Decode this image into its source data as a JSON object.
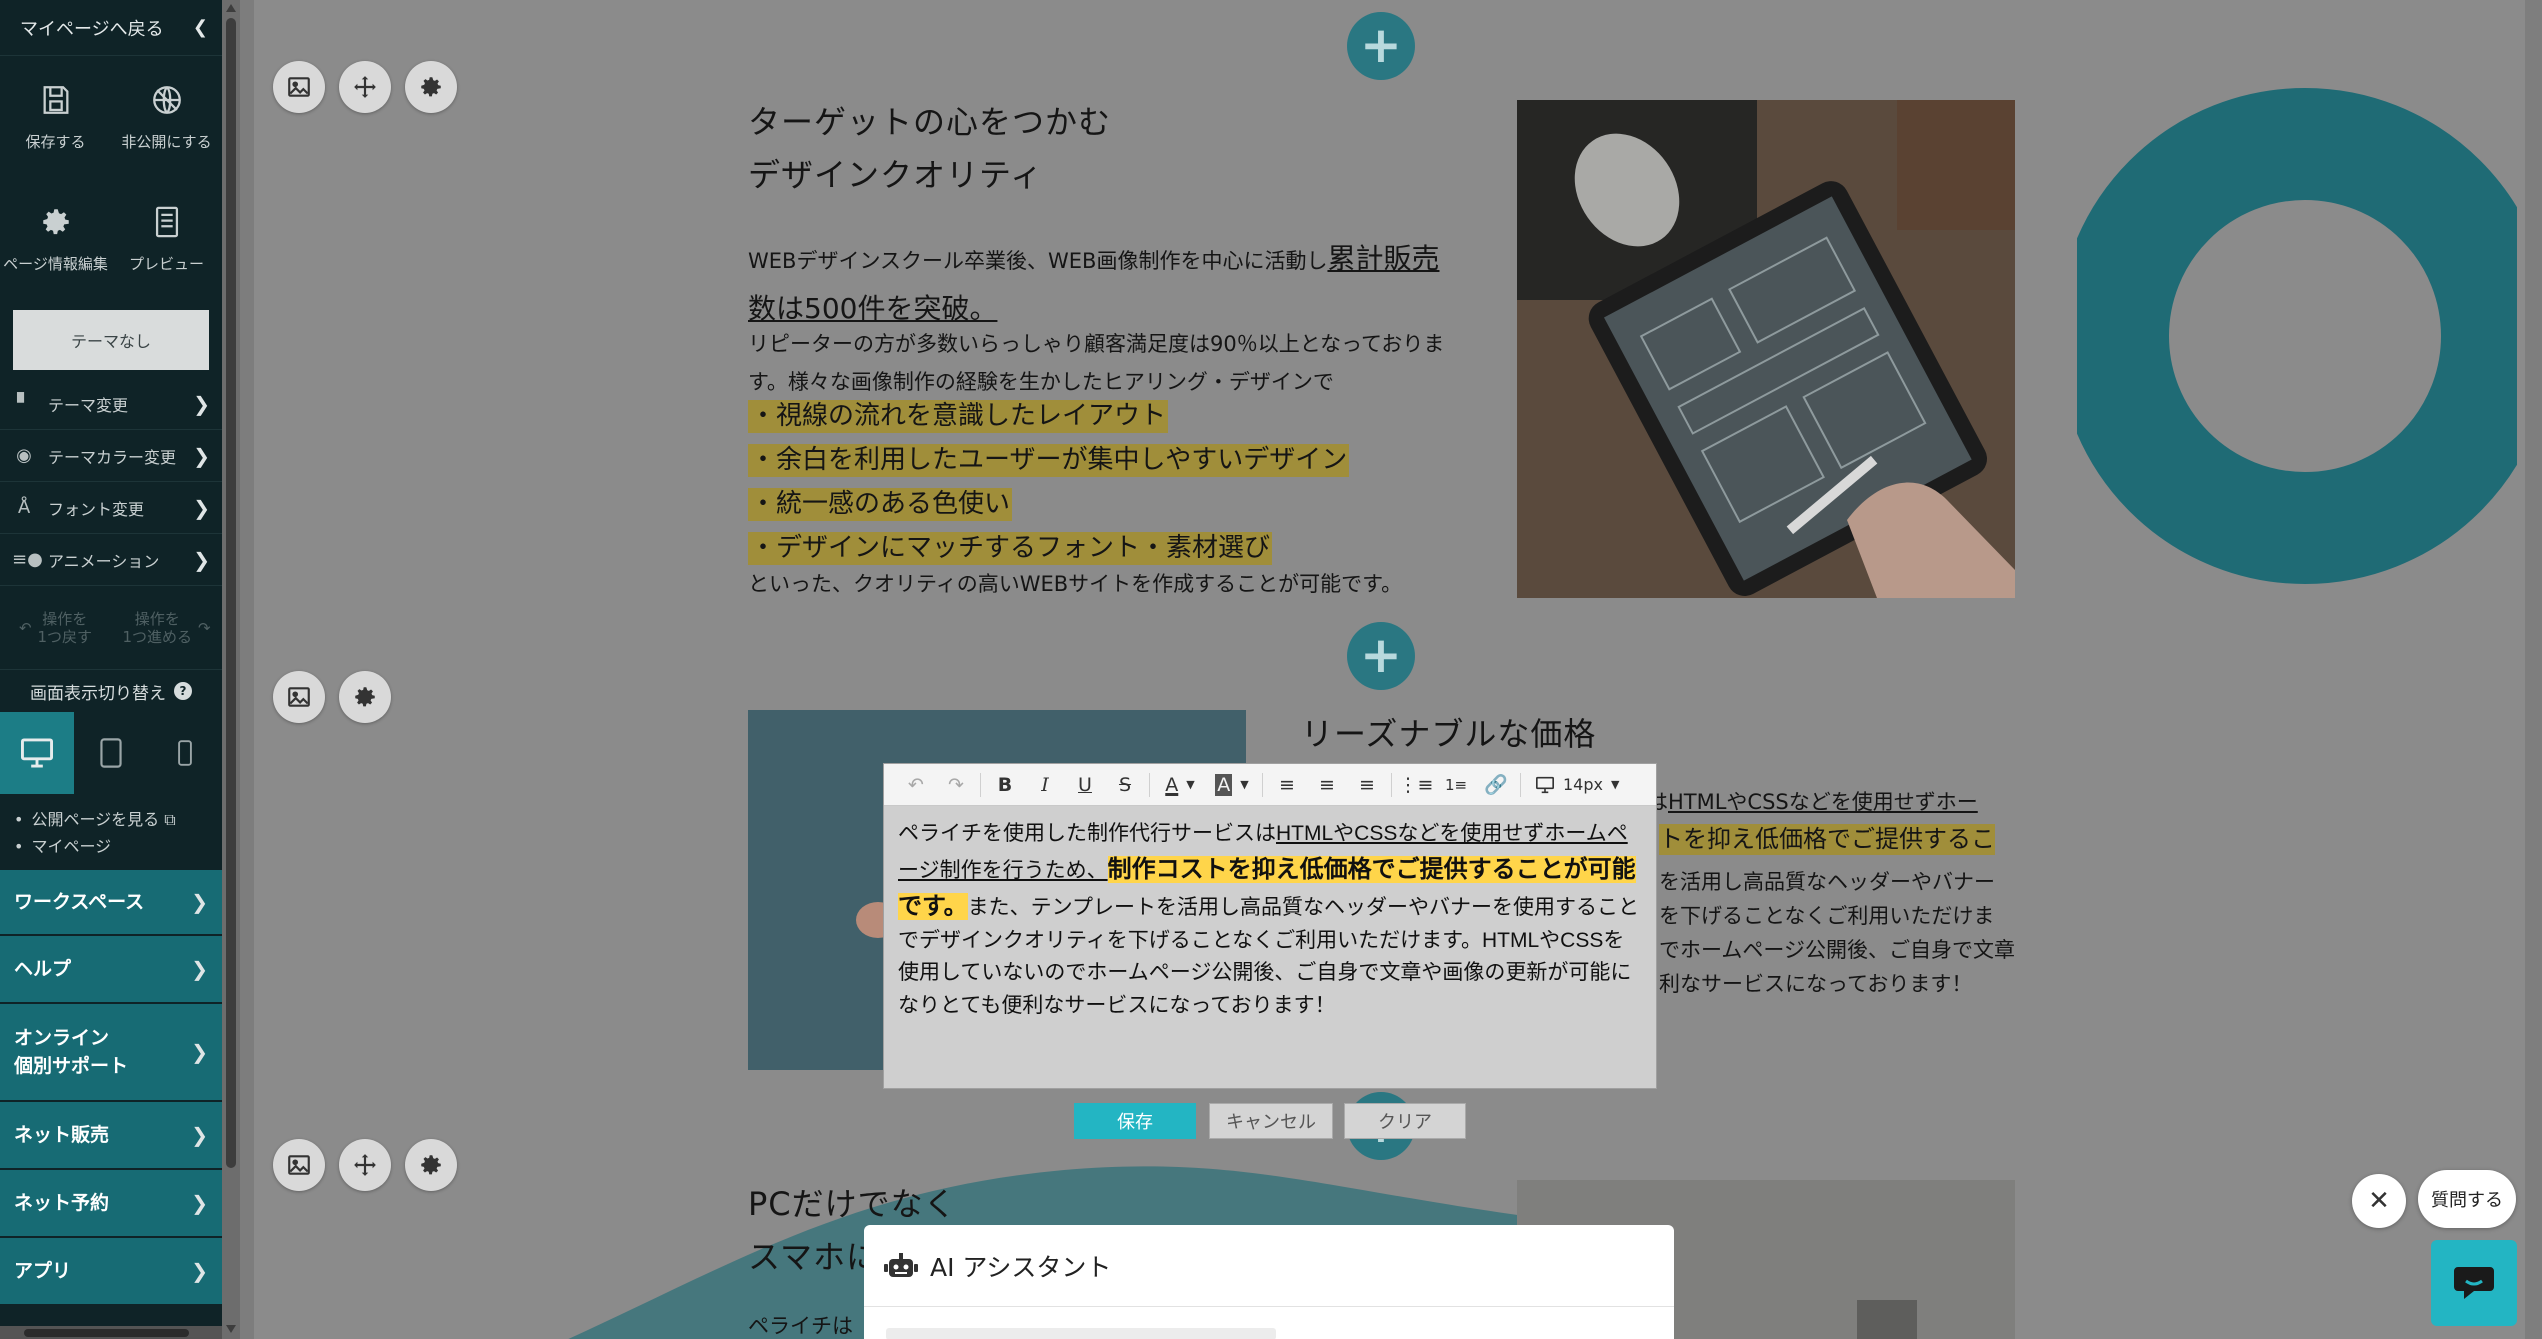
{
  "sidebar": {
    "back_label": "マイページへ戻る",
    "tiles": [
      {
        "label": "保存する",
        "icon": "save-icon"
      },
      {
        "label": "非公開にする",
        "icon": "unpublish-icon"
      },
      {
        "label": "ページ情報編集",
        "icon": "gear-icon"
      },
      {
        "label": "プレビュー",
        "icon": "preview-icon"
      }
    ],
    "theme_none": "テーマなし",
    "menu": [
      {
        "label": "テーマ変更",
        "icon": "paint-roller-icon"
      },
      {
        "label": "テーマカラー変更",
        "icon": "palette-icon"
      },
      {
        "label": "フォント変更",
        "icon": "font-icon"
      },
      {
        "label": "アニメーション",
        "icon": "animation-icon"
      }
    ],
    "undo_label": "操作を\n1つ戻す",
    "redo_label": "操作を\n1つ進める",
    "display_switch": "画面表示切り替え",
    "devices": [
      "desktop",
      "tablet",
      "mobile"
    ],
    "links": [
      "公開ページを見る",
      "マイページ"
    ],
    "big_menu": [
      "ワークスペース",
      "ヘルプ",
      "オンライン\n個別サポート",
      "ネット販売",
      "ネット予約",
      "アプリ"
    ]
  },
  "section1": {
    "title_line1": "ターゲットの心をつかむ",
    "title_line2": "デザインクオリティ",
    "para_a": "WEBデザインスクール卒業後、WEB画像制作を中心に活動し",
    "para_a_emph": "累計販売数は500件を突破。",
    "para_b": "リピーターの方が多数いらっしゃり顧客満足度は90％以上となっております。様々な画像制作の経験を生かしたヒアリング・デザインで",
    "bullets": [
      "・視線の流れを意識したレイアウト",
      "・余白を利用したユーザーが集中しやすいデザイン",
      "・統一感のある色使い",
      "・デザインにマッチするフォント・素材選び"
    ],
    "para_c": "といった、クオリティの高いWEBサイトを作成することが可能です。"
  },
  "section2": {
    "title": "リーズナブルな価格",
    "bg_line1_prefix": "は",
    "bg_line1_link": "HTMLやCSSなどを使用せずホー",
    "bg_line2": "トを抑え低価格でご提供するこ",
    "bg_line3": "を活用し高品質なヘッダーやバナー",
    "bg_line4": "を下げることなくご利用いただけま",
    "bg_line5": "でホームページ公開後、ご自身で文章",
    "bg_line6": "利なサービスになっております！"
  },
  "section3": {
    "title_line1": "PCだけでなく",
    "title_line2": "スマホに",
    "text_start": "ペライチは"
  },
  "editor": {
    "font_size": "14px",
    "text_1": "ペライチを使用した制作代行サービスは",
    "text_link": "HTMLやCSSなどを使用せずホームページ制作を行うため、",
    "text_strong": "制作コストを抑え低価格でご提供することが可能です。",
    "text_rest": "また、テンプレートを活用し高品質なヘッダーやバナーを使用することでデザインクオリティを下げることなくご利用いただけます。HTMLやCSSを使用していないのでホームページ公開後、ご自身で文章や画像の更新が可能になりとても便利なサービスになっております！",
    "save_label": "保存",
    "cancel_label": "キャンセル",
    "clear_label": "クリア"
  },
  "ai_panel": {
    "title": "AI アシスタント"
  },
  "floating": {
    "ask_label": "質問する"
  },
  "colors": {
    "sidebar_bg": "#0f2327",
    "accent": "#176b74",
    "plus_button": "#2a7782",
    "chat_button": "#23b5c3",
    "save_button": "#23b5c3",
    "highlight": "#ffd54a"
  }
}
